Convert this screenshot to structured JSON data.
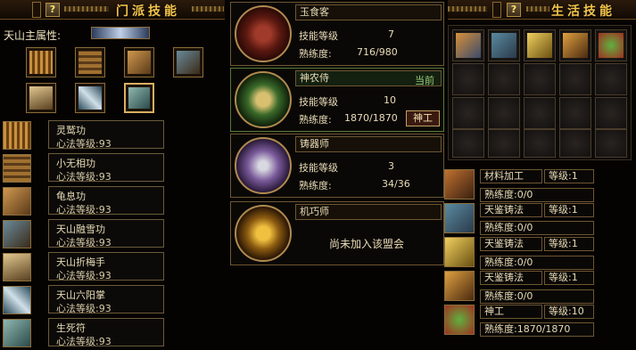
{
  "left_panel": {
    "title": "门派技能",
    "help": "?",
    "attribute_label": "天山主属性:",
    "skills": [
      {
        "name": "灵鹫功",
        "level": "心法等级:93"
      },
      {
        "name": "小无相功",
        "level": "心法等级:93"
      },
      {
        "name": "龟息功",
        "level": "心法等级:93"
      },
      {
        "name": "天山融雪功",
        "level": "心法等级:93"
      },
      {
        "name": "天山折梅手",
        "level": "心法等级:93"
      },
      {
        "name": "天山六阳掌",
        "level": "心法等级:93"
      },
      {
        "name": "生死符",
        "level": "心法等级:93"
      }
    ]
  },
  "middle_panel": {
    "cards": [
      {
        "name": "玉食客",
        "skill_label": "技能等级",
        "skill_value": "7",
        "prof_label": "熟练度:",
        "prof_value": "716/980"
      },
      {
        "name": "神农侍",
        "status": "当前",
        "skill_label": "技能等级",
        "skill_value": "10",
        "prof_label": "熟练度:",
        "prof_value": "1870/1870",
        "badge": "神工"
      },
      {
        "name": "铸器师",
        "skill_label": "技能等级",
        "skill_value": "3",
        "prof_label": "熟练度:",
        "prof_value": "34/36"
      },
      {
        "name": "机巧师",
        "message": "尚未加入该盟会"
      }
    ]
  },
  "right_panel": {
    "title": "生活技能",
    "help": "?",
    "entries": [
      {
        "name": "材料加工",
        "level": "等级:1",
        "prof": "熟练度:0/0"
      },
      {
        "name": "天鉴铸法",
        "level": "等级:1",
        "prof": "熟练度:0/0"
      },
      {
        "name": "天鉴铸法",
        "level": "等级:1",
        "prof": "熟练度:0/0"
      },
      {
        "name": "天鉴铸法",
        "level": "等级:1",
        "prof": "熟练度:0/0"
      },
      {
        "name": "神工",
        "level": "等级:10",
        "prof": "熟练度:1870/1870"
      }
    ]
  },
  "colors": {
    "gold": "#f3c44a",
    "border": "#8b6d3a",
    "current_green": "#3a6a2a"
  },
  "icons": [
    "scroll-icon",
    "book-icon",
    "sword-icon",
    "gear-icon",
    "anvil-icon"
  ]
}
